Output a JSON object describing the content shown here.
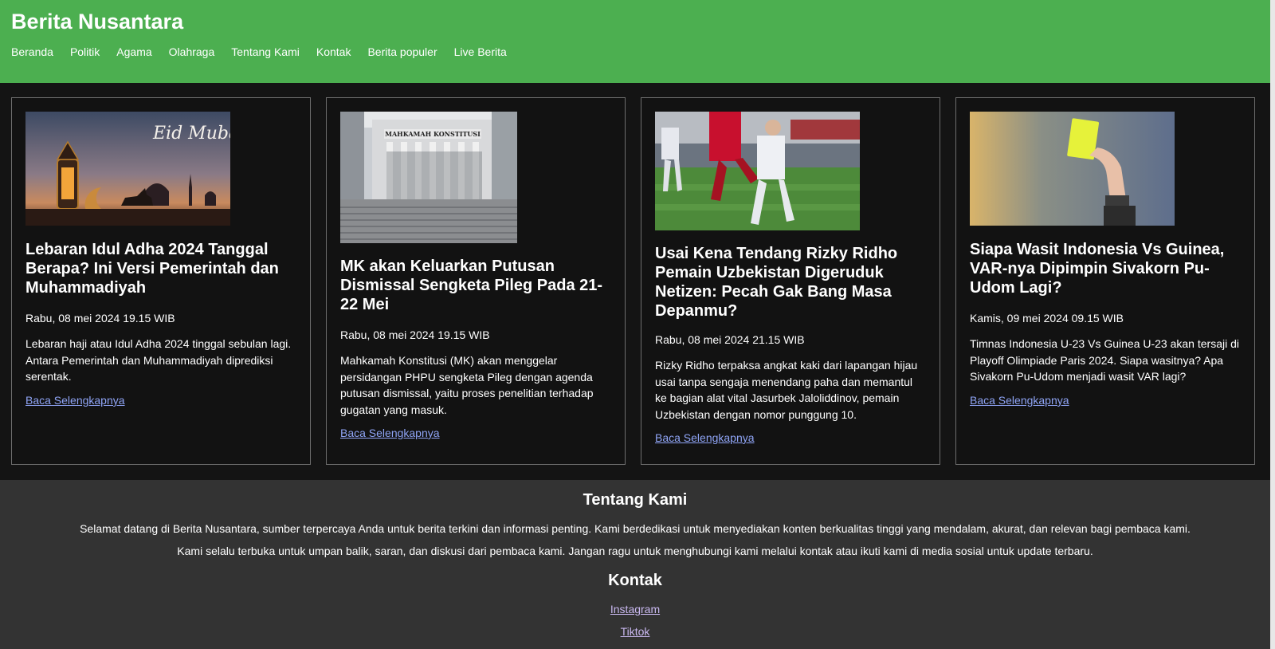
{
  "site": {
    "title": "Berita Nusantara"
  },
  "nav": [
    "Beranda",
    "Politik",
    "Agama",
    "Olahraga",
    "Tentang Kami",
    "Kontak",
    "Berita populer",
    "Live Berita"
  ],
  "articles": [
    {
      "image": "eid-mubarak-mosque-lantern-illustration",
      "image_text": "Eid Mubarak",
      "title": "Lebaran Idul Adha 2024 Tanggal Berapa? Ini Versi Pemerintah dan Muhammadiyah",
      "date": "Rabu, 08 mei 2024 19.15 WIB",
      "summary": "Lebaran haji atau Idul Adha 2024 tinggal sebulan lagi. Antara Pemerintah dan Muhammadiyah diprediksi serentak.",
      "link": "Baca Selengkapnya"
    },
    {
      "image": "mahkamah-konstitusi-building-photo",
      "image_text": "MAHKAMAH KONSTITUSI",
      "title": "MK akan Keluarkan Putusan Dismissal Sengketa Pileg Pada 21-22 Mei",
      "date": "Rabu, 08 mei 2024 19.15 WIB",
      "summary": "Mahkamah Konstitusi (MK) akan menggelar persidangan PHPU sengketa Pileg dengan agenda putusan dismissal, yaitu proses penelitian terhadap gugatan yang masuk.",
      "link": "Baca Selengkapnya"
    },
    {
      "image": "football-match-photo",
      "title": "Usai Kena Tendang Rizky Ridho Pemain Uzbekistan Digeruduk Netizen: Pecah Gak Bang Masa Depanmu?",
      "date": "Rabu, 08 mei 2024 21.15 WIB",
      "summary": "Rizky Ridho terpaksa angkat kaki dari lapangan hijau usai tanpa sengaja menendang paha dan memantul ke bagian alat vital Jasurbek Jaloliddinov, pemain Uzbekistan dengan nomor punggung 10.",
      "link": "Baca Selengkapnya"
    },
    {
      "image": "referee-yellow-card-photo",
      "title": "Siapa Wasit Indonesia Vs Guinea, VAR-nya Dipimpin Sivakorn Pu-Udom Lagi?",
      "date": "Kamis, 09 mei 2024 09.15 WIB",
      "summary": "Timnas Indonesia U-23 Vs Guinea U-23 akan tersaji di Playoff Olimpiade Paris 2024. Siapa wasitnya? Apa Sivakorn Pu-Udom menjadi wasit VAR lagi?",
      "link": "Baca Selengkapnya"
    }
  ],
  "footer": {
    "about_title": "Tentang Kami",
    "about_p1": "Selamat datang di Berita Nusantara, sumber terpercaya Anda untuk berita terkini dan informasi penting. Kami berdedikasi untuk menyediakan konten berkualitas tinggi yang mendalam, akurat, dan relevan bagi pembaca kami.",
    "about_p2": "Kami selalu terbuka untuk umpan balik, saran, dan diskusi dari pembaca kami. Jangan ragu untuk menghubungi kami melalui kontak atau ikuti kami di media sosial untuk update terbaru.",
    "contact_title": "Kontak",
    "links": [
      "Instagram",
      "Tiktok"
    ]
  },
  "colors": {
    "header": "#4caf50",
    "card_bg": "#121212",
    "footer_bg": "#333333",
    "link": "#8fa4f5"
  }
}
